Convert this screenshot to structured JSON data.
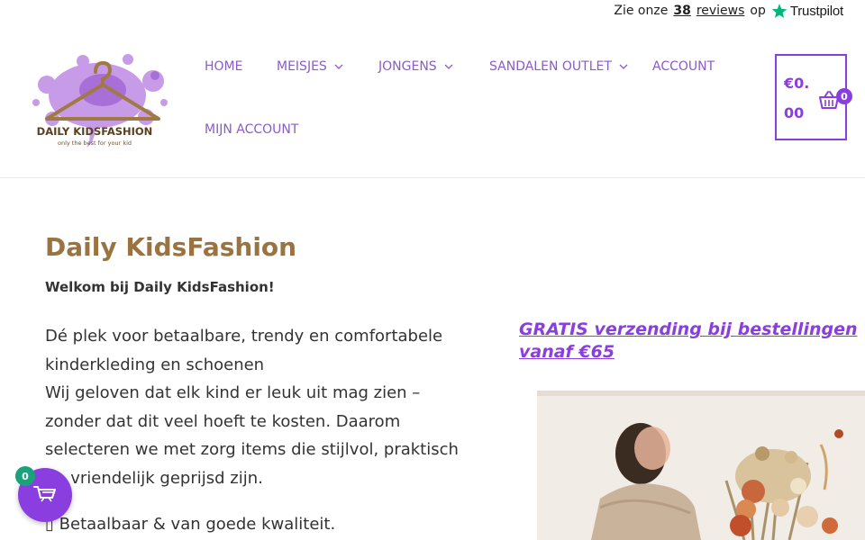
{
  "trustpilot": {
    "prefix": "Zie onze",
    "count": "38",
    "reviews": "reviews",
    "suffix": "op",
    "brand": "Trustpilot",
    "star_color": "#00b67a"
  },
  "logo": {
    "alt": "Daily KidsFashion",
    "wordmark": "DAILY KIDSFASHION",
    "tagline": "only the best for your kid"
  },
  "nav": {
    "items": [
      {
        "label": "HOME",
        "has_dropdown": false
      },
      {
        "label": "MEISJES",
        "has_dropdown": true
      },
      {
        "label": "JONGENS",
        "has_dropdown": true
      },
      {
        "label": "SANDALEN OUTLET",
        "has_dropdown": true
      },
      {
        "label": "ACCOUNT",
        "has_dropdown": false
      },
      {
        "label": "MIJN ACCOUNT",
        "has_dropdown": false
      }
    ]
  },
  "cart": {
    "amount": "€0.00",
    "count": "0"
  },
  "main": {
    "title": "Daily KidsFashion",
    "welcome": "Welkom bij Daily KidsFashion!",
    "intro": "Dé plek voor betaalbare, trendy en comfortabele kinderkleding en schoenen\nWij geloven dat elk kind er leuk uit mag zien – zonder dat dit veel hoeft te kosten. Daarom selecteren we met zorg items die stijlvol, praktisch en vriendelijk geprijsd zijn.",
    "bullet": "Betaalbaar & van goede kwaliteit.",
    "shipping": "GRATIS verzending bij bestellingen vanaf €65"
  },
  "float_cart": {
    "count": "0",
    "icon": "shopping-cart-icon"
  },
  "colors": {
    "accent": "#8a3ee0",
    "nav_text": "#8a5cc6",
    "title": "#9b7340",
    "badge_green": "#1aa37a"
  }
}
